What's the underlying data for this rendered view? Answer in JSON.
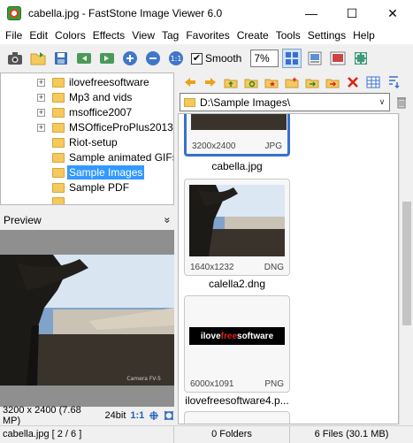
{
  "window": {
    "title": "cabella.jpg  -  FastStone Image Viewer 6.0",
    "min_glyph": "—",
    "max_glyph": "☐",
    "close_glyph": "✕"
  },
  "menu": [
    "File",
    "Edit",
    "Colors",
    "Effects",
    "View",
    "Tag",
    "Favorites",
    "Create",
    "Tools",
    "Settings",
    "Help"
  ],
  "toolbar": {
    "smooth_label": "Smooth",
    "smooth_checked": "✔",
    "zoom_value": "7%"
  },
  "tree": {
    "expander_glyph": "+",
    "items": [
      {
        "label": "ilovefreesoftware",
        "expandable": true
      },
      {
        "label": "Mp3 and vids",
        "expandable": true
      },
      {
        "label": "msoffice2007",
        "expandable": true
      },
      {
        "label": "MSOfficeProPlus2013",
        "expandable": true
      },
      {
        "label": "Riot-setup",
        "expandable": false
      },
      {
        "label": "Sample animated GIFs",
        "expandable": false
      },
      {
        "label": "Sample Images",
        "expandable": false,
        "selected": true
      },
      {
        "label": "Sample PDF",
        "expandable": false
      },
      {
        "label": "",
        "expandable": false
      }
    ]
  },
  "preview": {
    "header": "Preview",
    "collapse_glyph": "»",
    "dims": "3200 x 2400 (7.68 MP)",
    "bits": "24bit",
    "ratio": "1:1",
    "watermark": "Camera FV-5"
  },
  "path": {
    "value": "D:\\Sample Images\\",
    "drop_glyph": "∨"
  },
  "thumbnails": [
    {
      "name": "cabella.jpg",
      "dims": "3200x2400",
      "type": "JPG",
      "selected": true
    },
    {
      "name": "calella2.dng",
      "dims": "1640x1232",
      "type": "DNG",
      "selected": false
    },
    {
      "name": "ilovefreesoftware4.p...",
      "dims": "6000x1091",
      "type": "PNG",
      "selected": false,
      "logo": {
        "part1": "ilove",
        "part2": "free",
        "part3": "software"
      }
    }
  ],
  "status": {
    "file": "cabella.jpg [ 2 / 6 ]",
    "folders": "0 Folders",
    "files": "6 Files (30.1 MB)"
  },
  "colors": {
    "accent": "#3399ff",
    "selection_border": "#3a6fd0",
    "folder": "#f4c95d"
  }
}
